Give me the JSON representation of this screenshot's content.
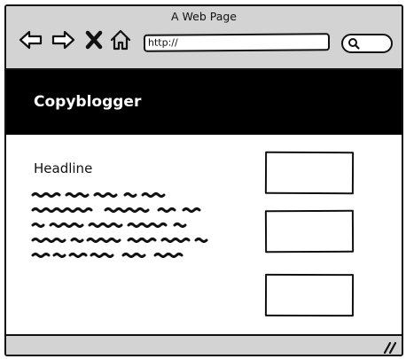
{
  "window": {
    "title": "A Web Page"
  },
  "toolbar": {
    "url": "http://",
    "icons": [
      "back-arrow-icon",
      "forward-arrow-icon",
      "close-x-icon",
      "home-icon",
      "search-icon"
    ]
  },
  "site": {
    "name": "Copyblogger"
  },
  "article": {
    "headline": "Headline"
  },
  "colors": {
    "chrome": "#d3d3d3",
    "header_bg": "#000000",
    "header_text": "#ffffff"
  }
}
